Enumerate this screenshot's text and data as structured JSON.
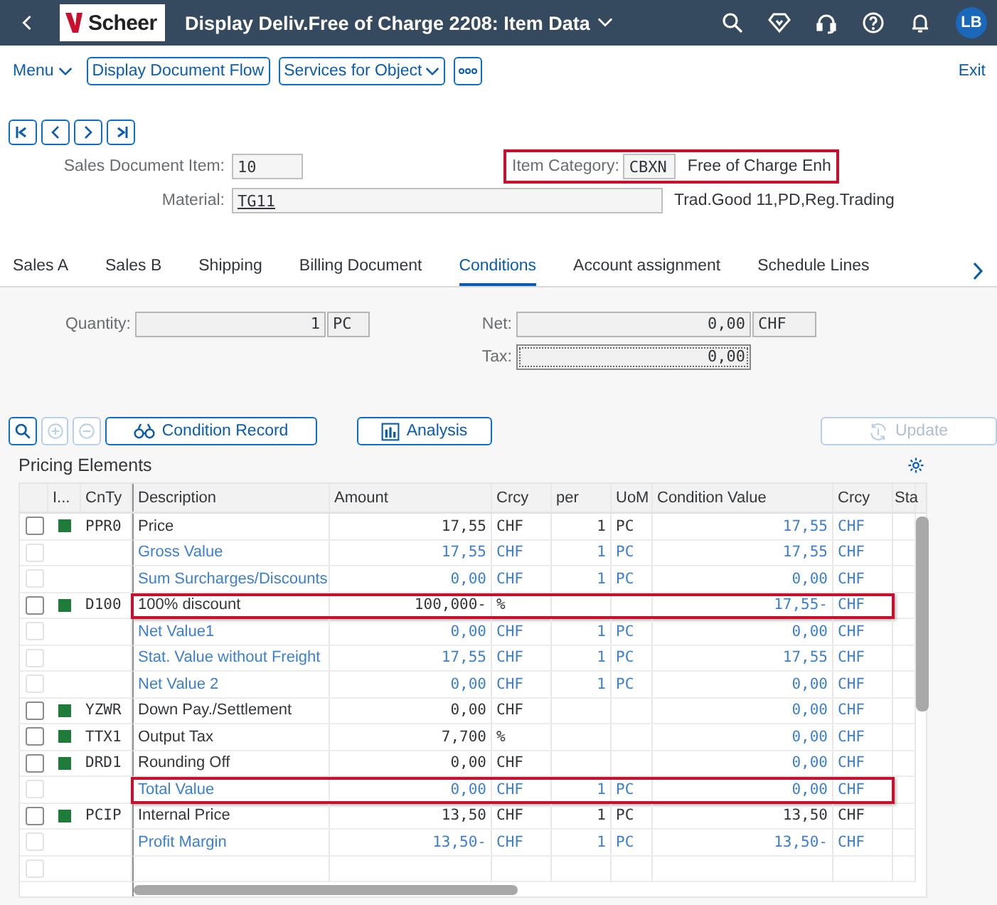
{
  "header": {
    "title": "Display Deliv.Free of Charge 2208: Item Data",
    "logo": "Scheer",
    "avatar": "LB"
  },
  "toolbar": {
    "menu": "Menu",
    "buttons": [
      {
        "label": "Display Document Flow",
        "dropdown": false
      },
      {
        "label": "Services for Object",
        "dropdown": true
      }
    ],
    "exit": "Exit"
  },
  "sales_document_item": {
    "label": "Sales Document Item:",
    "value": "10"
  },
  "item_category": {
    "label": "Item Category:",
    "value": "CBXN",
    "description": "Free of Charge Enh",
    "highlighted": true
  },
  "material": {
    "label": "Material:",
    "value": "TG11",
    "description": "Trad.Good 11,PD,Reg.Trading"
  },
  "tabs": [
    {
      "label": "Sales A",
      "selected": false
    },
    {
      "label": "Sales B",
      "selected": false
    },
    {
      "label": "Shipping",
      "selected": false
    },
    {
      "label": "Billing Document",
      "selected": false
    },
    {
      "label": "Conditions",
      "selected": true
    },
    {
      "label": "Account assignment",
      "selected": false
    },
    {
      "label": "Schedule Lines",
      "selected": false
    }
  ],
  "totals": {
    "quantity": {
      "label": "Quantity:",
      "value": "1",
      "unit": "PC"
    },
    "net": {
      "label": "Net:",
      "value": "0,00",
      "unit": "CHF"
    },
    "tax": {
      "label": "Tax:",
      "value": "0,00"
    }
  },
  "table_tools": [
    {
      "kind": "zoom",
      "disabled": false
    },
    {
      "kind": "add",
      "disabled": true
    },
    {
      "kind": "remove",
      "disabled": true
    }
  ],
  "actions": [
    {
      "kind": "record",
      "label": "Condition Record",
      "disabled": false
    },
    {
      "kind": "analysis",
      "label": "Analysis",
      "disabled": false
    },
    {
      "kind": "update",
      "label": "Update",
      "disabled": true
    }
  ],
  "pricing": {
    "title": "Pricing Elements",
    "columns": [
      "I...",
      "CnTy",
      "Description",
      "Amount",
      "Crcy",
      "per",
      "UoM",
      "Condition Value",
      "Crcy",
      "Sta"
    ],
    "rows": [
      {
        "kind": "condition",
        "checked": false,
        "indicator": true,
        "highlighted": false,
        "cnty": "PPR0",
        "description": "Price",
        "amount": "17,55",
        "crcy": "CHF",
        "per": "1",
        "uom": "PC",
        "value": "17,55",
        "value_crcy": "CHF"
      },
      {
        "kind": "subtotal",
        "checked": false,
        "indicator": false,
        "highlighted": false,
        "description": "Gross Value",
        "amount": "17,55",
        "crcy": "CHF",
        "per": "1",
        "uom": "PC",
        "value": "17,55",
        "value_crcy": "CHF"
      },
      {
        "kind": "subtotal",
        "checked": false,
        "indicator": false,
        "highlighted": false,
        "description": "Sum Surcharges/Discounts",
        "amount": "0,00",
        "crcy": "CHF",
        "per": "1",
        "uom": "PC",
        "value": "0,00",
        "value_crcy": "CHF"
      },
      {
        "kind": "condition",
        "checked": false,
        "indicator": true,
        "highlighted": true,
        "cnty": "D100",
        "description": "100% discount",
        "amount": "100,000-",
        "crcy": "%",
        "value": "17,55-",
        "value_crcy": "CHF"
      },
      {
        "kind": "subtotal",
        "checked": false,
        "indicator": false,
        "highlighted": false,
        "description": "Net Value1",
        "amount": "0,00",
        "crcy": "CHF",
        "per": "1",
        "uom": "PC",
        "value": "0,00",
        "value_crcy": "CHF"
      },
      {
        "kind": "subtotal",
        "checked": false,
        "indicator": false,
        "highlighted": false,
        "description": "Stat. Value without Freight",
        "amount": "17,55",
        "crcy": "CHF",
        "per": "1",
        "uom": "PC",
        "value": "17,55",
        "value_crcy": "CHF"
      },
      {
        "kind": "subtotal",
        "checked": false,
        "indicator": false,
        "highlighted": false,
        "description": "Net Value 2",
        "amount": "0,00",
        "crcy": "CHF",
        "per": "1",
        "uom": "PC",
        "value": "0,00",
        "value_crcy": "CHF"
      },
      {
        "kind": "condition",
        "checked": false,
        "indicator": true,
        "highlighted": false,
        "cnty": "YZWR",
        "description": "Down Pay./Settlement",
        "amount": "0,00",
        "crcy": "CHF",
        "value": "0,00",
        "value_crcy": "CHF"
      },
      {
        "kind": "condition",
        "checked": false,
        "indicator": true,
        "highlighted": false,
        "cnty": "TTX1",
        "description": "Output Tax",
        "amount": "7,700",
        "crcy": "%",
        "value": "0,00",
        "value_crcy": "CHF"
      },
      {
        "kind": "condition",
        "checked": false,
        "indicator": true,
        "highlighted": false,
        "cnty": "DRD1",
        "description": "Rounding Off",
        "amount": "0,00",
        "crcy": "CHF",
        "value": "0,00",
        "value_crcy": "CHF"
      },
      {
        "kind": "subtotal",
        "checked": false,
        "indicator": false,
        "highlighted": true,
        "description": "Total Value",
        "amount": "0,00",
        "crcy": "CHF",
        "per": "1",
        "uom": "PC",
        "value": "0,00",
        "value_crcy": "CHF"
      },
      {
        "kind": "statistical",
        "checked": false,
        "indicator": true,
        "highlighted": false,
        "cnty": "PCIP",
        "description": "Internal Price",
        "amount": "13,50",
        "crcy": "CHF",
        "per": "1",
        "uom": "PC",
        "value": "13,50",
        "value_crcy": "CHF"
      },
      {
        "kind": "subtotal",
        "checked": false,
        "indicator": false,
        "highlighted": false,
        "description": "Profit Margin",
        "amount": "13,50-",
        "crcy": "CHF",
        "per": "1",
        "uom": "PC",
        "value": "13,50-",
        "value_crcy": "CHF"
      },
      {
        "kind": "subtotal",
        "checked": false,
        "indicator": false,
        "highlighted": false
      }
    ]
  }
}
